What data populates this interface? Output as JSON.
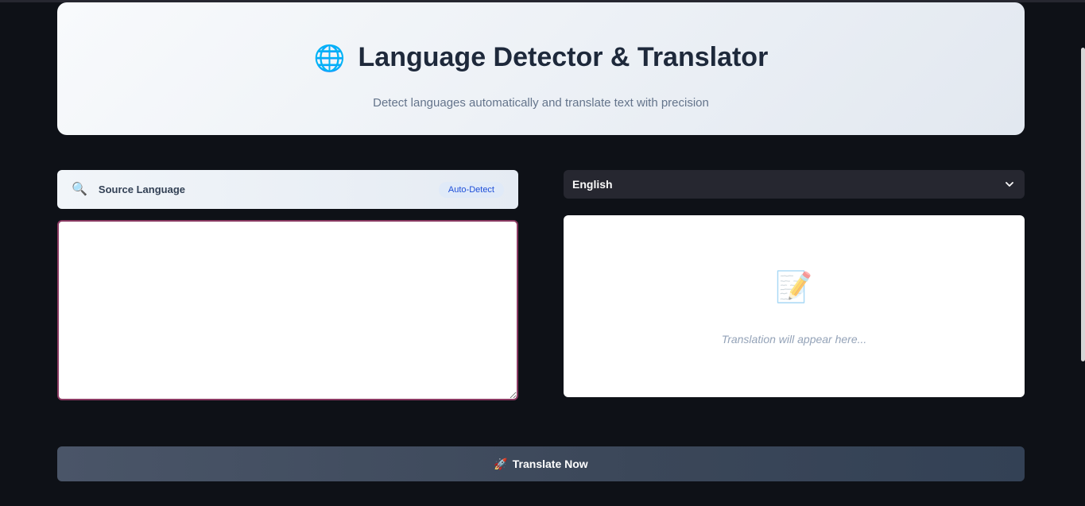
{
  "header": {
    "icon": "globe-icon",
    "title": "Language Detector & Translator",
    "subtitle": "Detect languages automatically and translate text with precision"
  },
  "source": {
    "icon": "magnifier-icon",
    "label": "Source Language",
    "badge": "Auto-Detect",
    "input_value": "",
    "border_color": "#8b3a62"
  },
  "target": {
    "selected_language": "English",
    "output_icon": "memo-icon",
    "output_placeholder": "Translation will appear here..."
  },
  "action": {
    "icon": "rocket-icon",
    "label": "Translate Now"
  },
  "colors": {
    "background": "#0e1117",
    "select_bg": "#262730",
    "badge_text": "#1d4ed8"
  }
}
